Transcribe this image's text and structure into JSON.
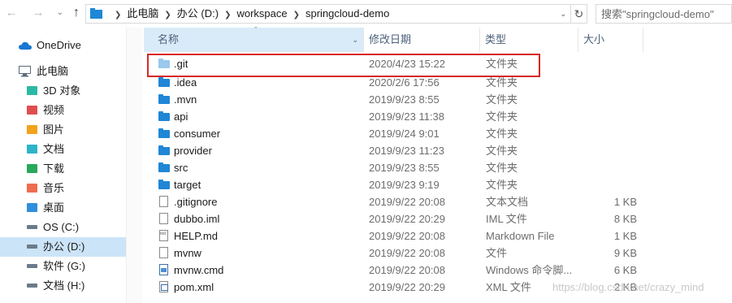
{
  "address_bar": {
    "breadcrumbs": [
      "此电脑",
      "办公 (D:)",
      "workspace",
      "springcloud-demo"
    ],
    "search_placeholder": "搜索\"springcloud-demo\""
  },
  "nav_pane": {
    "items": [
      {
        "label": "OneDrive",
        "icon": "onedrive-cloud-icon",
        "color": "#1976d2"
      },
      {
        "label": "此电脑",
        "icon": "computer-icon",
        "color": "#5a6b7b"
      },
      {
        "label": "3D 对象",
        "icon": "3d-objects-icon",
        "color": "#2bb9a4"
      },
      {
        "label": "视频",
        "icon": "videos-icon",
        "color": "#e04f4f"
      },
      {
        "label": "图片",
        "icon": "pictures-icon",
        "color": "#f2a31b"
      },
      {
        "label": "文档",
        "icon": "documents-icon",
        "color": "#2fb3c8"
      },
      {
        "label": "下载",
        "icon": "downloads-icon",
        "color": "#26a95a"
      },
      {
        "label": "音乐",
        "icon": "music-icon",
        "color": "#ef6c4f"
      },
      {
        "label": "桌面",
        "icon": "desktop-icon",
        "color": "#2f8fdc"
      },
      {
        "label": "OS (C:)",
        "icon": "drive-icon",
        "color": "#6b7b8a"
      },
      {
        "label": "办公 (D:)",
        "icon": "drive-icon",
        "color": "#6b7b8a",
        "selected": true
      },
      {
        "label": "软件 (G:)",
        "icon": "drive-icon",
        "color": "#6b7b8a"
      },
      {
        "label": "文档 (H:)",
        "icon": "drive-icon",
        "color": "#6b7b8a"
      }
    ]
  },
  "columns": {
    "name": "名称",
    "date": "修改日期",
    "type": "类型",
    "size": "大小"
  },
  "files": [
    {
      "name": ".git",
      "date": "2020/4/23 15:22",
      "type": "文件夹",
      "size": "",
      "icon": "folder-light",
      "highlighted": true
    },
    {
      "name": ".idea",
      "date": "2020/2/6 17:56",
      "type": "文件夹",
      "size": "",
      "icon": "folder-dark"
    },
    {
      "name": ".mvn",
      "date": "2019/9/23 8:55",
      "type": "文件夹",
      "size": "",
      "icon": "folder-dark"
    },
    {
      "name": "api",
      "date": "2019/9/23 11:38",
      "type": "文件夹",
      "size": "",
      "icon": "folder-dark"
    },
    {
      "name": "consumer",
      "date": "2019/9/24 9:01",
      "type": "文件夹",
      "size": "",
      "icon": "folder-dark"
    },
    {
      "name": "provider",
      "date": "2019/9/23 11:23",
      "type": "文件夹",
      "size": "",
      "icon": "folder-dark"
    },
    {
      "name": "src",
      "date": "2019/9/23 8:55",
      "type": "文件夹",
      "size": "",
      "icon": "folder-dark"
    },
    {
      "name": "target",
      "date": "2019/9/23 9:19",
      "type": "文件夹",
      "size": "",
      "icon": "folder-dark"
    },
    {
      "name": ".gitignore",
      "date": "2019/9/22 20:08",
      "type": "文本文档",
      "size": "1 KB",
      "icon": "file"
    },
    {
      "name": "dubbo.iml",
      "date": "2019/9/22 20:29",
      "type": "IML 文件",
      "size": "8 KB",
      "icon": "file"
    },
    {
      "name": "HELP.md",
      "date": "2019/9/22 20:08",
      "type": "Markdown File",
      "size": "1 KB",
      "icon": "file-md"
    },
    {
      "name": "mvnw",
      "date": "2019/9/22 20:08",
      "type": "文件",
      "size": "9 KB",
      "icon": "file"
    },
    {
      "name": "mvnw.cmd",
      "date": "2019/9/22 20:08",
      "type": "Windows 命令脚...",
      "size": "6 KB",
      "icon": "file-cmd"
    },
    {
      "name": "pom.xml",
      "date": "2019/9/22 20:29",
      "type": "XML 文件",
      "size": "2 KB",
      "icon": "file-xml"
    }
  ],
  "watermark": "https://blog.csdn.net/crazy_mind"
}
